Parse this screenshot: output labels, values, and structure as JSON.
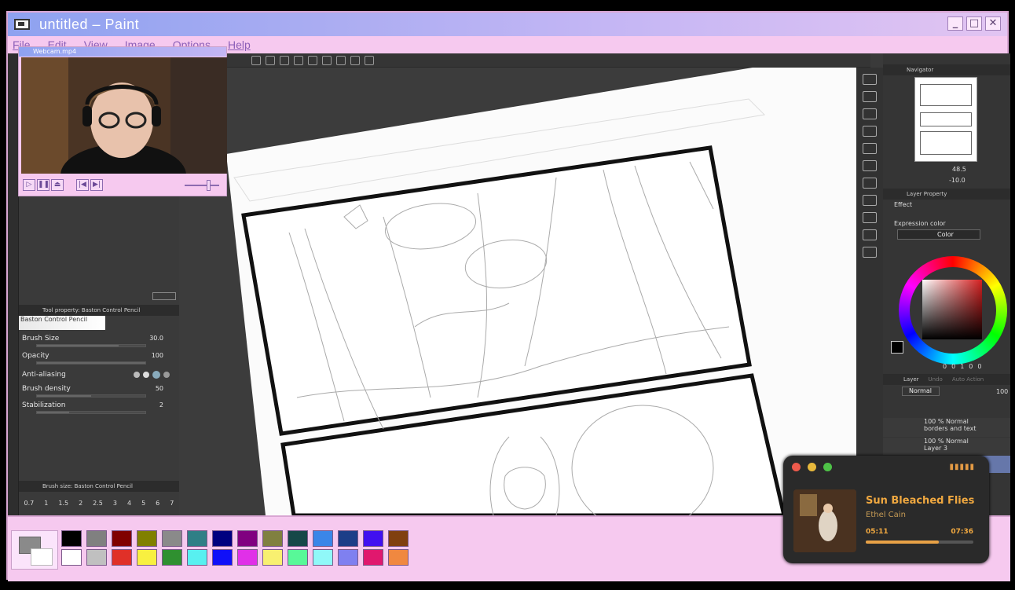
{
  "window": {
    "title": "untitled – Paint",
    "minimize": "_",
    "maximize": "□",
    "close": "✕"
  },
  "menu": [
    "File",
    "Edit",
    "View",
    "Image",
    "Options",
    "Help"
  ],
  "webcam": {
    "title": "Webcam.mp4",
    "buttons": [
      "▷",
      "❚❚",
      "⏏",
      "|◀",
      "▶|"
    ]
  },
  "tool_property": {
    "header": "Tool property: Baston Control Pencil",
    "brush_name": "Baston Control Pencil",
    "rows": [
      {
        "label": "Brush Size",
        "value": "30.0",
        "fraction": 0.75
      },
      {
        "label": "Opacity",
        "value": "100",
        "fraction": 1.0
      },
      {
        "label": "Anti-aliasing",
        "value": ""
      },
      {
        "label": "Brush density",
        "value": "50",
        "fraction": 0.5
      },
      {
        "label": "Stabilization",
        "value": "2",
        "fraction": 0.3
      }
    ]
  },
  "brush_size_panel": {
    "header": "Brush size: Baston Control Pencil",
    "sizes": [
      "0.7",
      "1",
      "1.5",
      "2",
      "2.5",
      "3",
      "4",
      "5",
      "6",
      "7"
    ]
  },
  "navigator": {
    "title": "Navigator",
    "zoom": "48.5",
    "rotation": "-10.0"
  },
  "layer_property": {
    "title": "Layer Property",
    "effect": "Effect",
    "expression_color": "Expression color",
    "color_value": "Color"
  },
  "color_wheel": {
    "readout": [
      "0",
      "0",
      "1",
      "0",
      "0"
    ]
  },
  "layers": {
    "tabs": [
      "Layer",
      "Undo",
      "Auto Action"
    ],
    "blend_mode": "Normal",
    "opacity": "100",
    "items": [
      {
        "opacity_mode": "100 % Normal",
        "name": "borders and text"
      },
      {
        "opacity_mode": "100 % Normal",
        "name": "Layer 3"
      }
    ]
  },
  "palette": {
    "fg": "#8a8a8a",
    "top_row": [
      "#000000",
      "#808080",
      "#800000",
      "#808000",
      "#8a8a8a",
      "#2f7f86",
      "#000080",
      "#800080",
      "#808040",
      "#164848",
      "#3a86e8",
      "#1c3e88",
      "#4010f0",
      "#804010"
    ],
    "bottom_row": [
      "#ffffff",
      "#c0c0c0",
      "#e03028",
      "#f8f040",
      "#2f9030",
      "#58f0f0",
      "#1010f8",
      "#e030e8",
      "#f8f070",
      "#58f898",
      "#90f8f8",
      "#7f80f0",
      "#e0186e",
      "#f08840"
    ]
  },
  "music": {
    "title": "Sun Bleached Flies",
    "artist": "Ethel Cain",
    "elapsed": "05:11",
    "total": "07:36",
    "progress": 0.68,
    "accent": "#f0a840"
  }
}
